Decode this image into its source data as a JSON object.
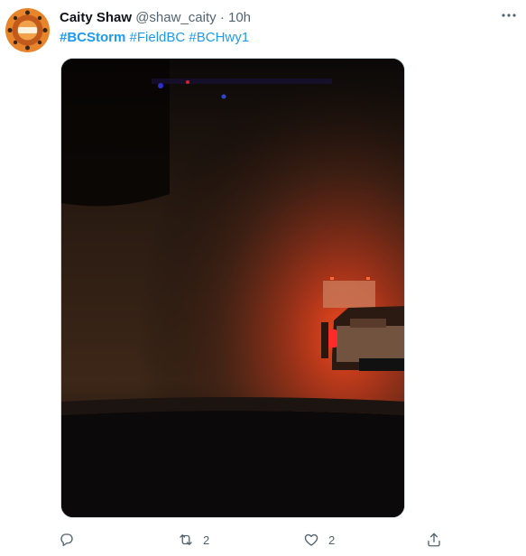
{
  "author": {
    "name": "Caity Shaw",
    "handle": "@shaw_caity",
    "separator": "·",
    "time": "10h",
    "avatar_icon": "avatar-badge-icon"
  },
  "hashtags": [
    "#BCStorm",
    "#FieldBC",
    "#BCHwy1"
  ],
  "actions": {
    "reply_count": "",
    "retweet_count": "2",
    "like_count": "2"
  },
  "colors": {
    "link": "#1d9bf0",
    "secondary_text": "#536471",
    "avatar_bg": "#e8852a"
  }
}
